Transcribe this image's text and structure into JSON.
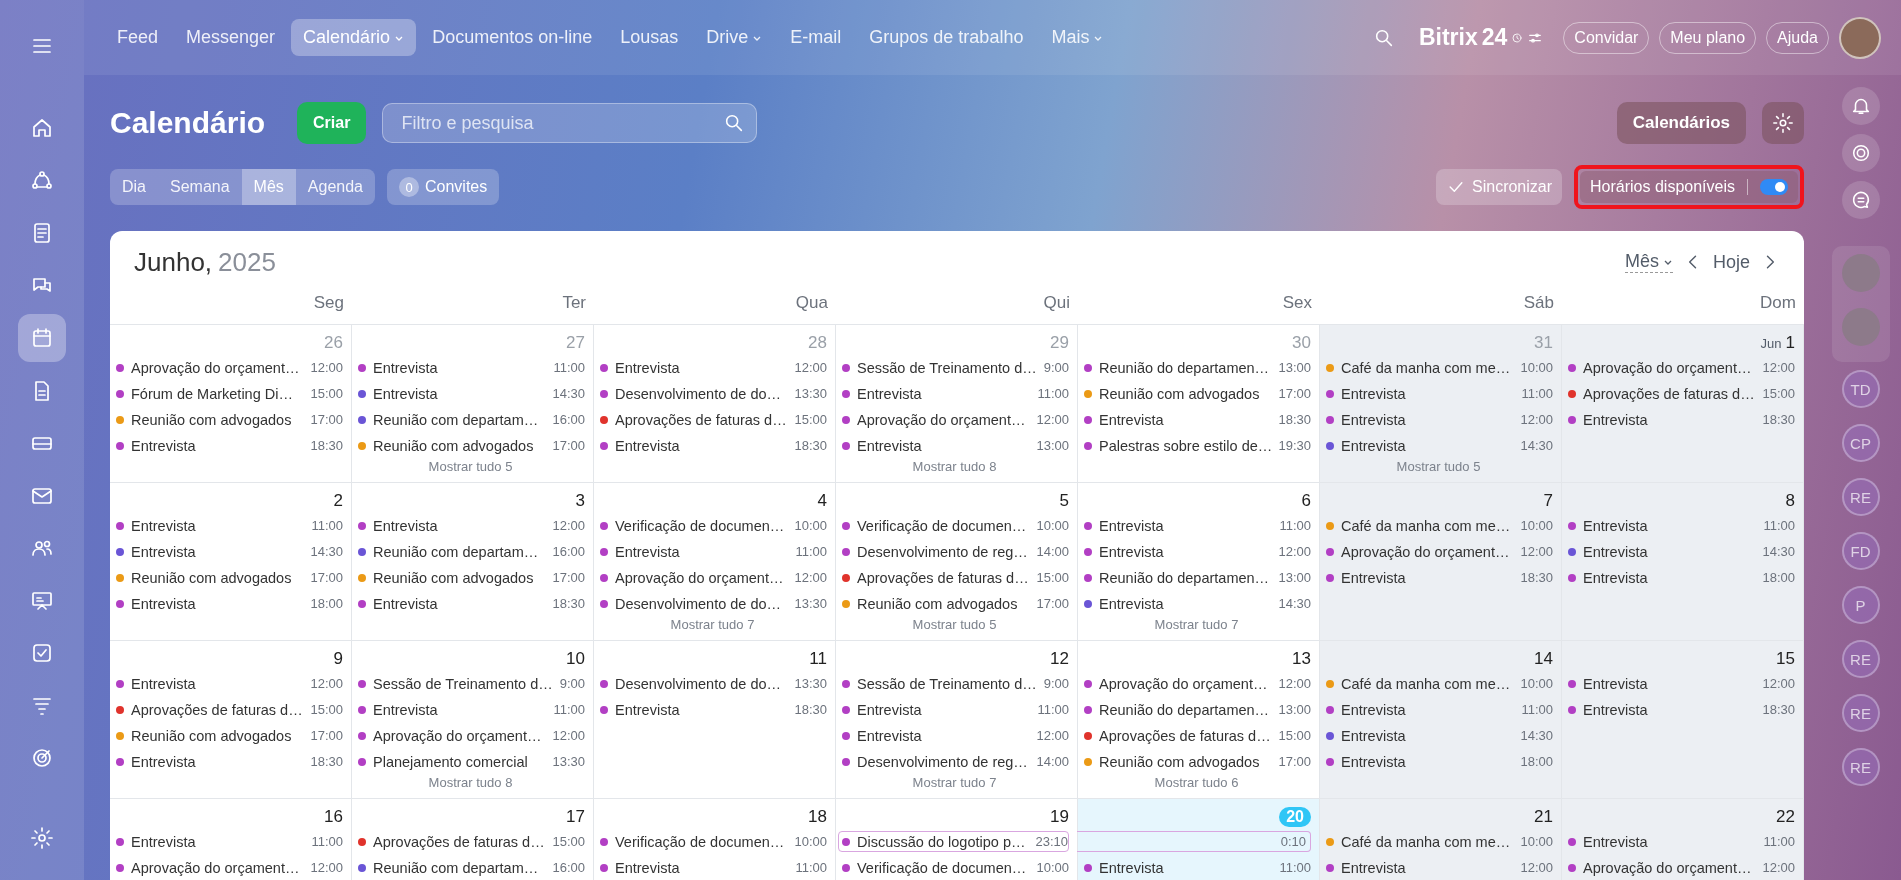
{
  "left_sidebar": {
    "items": [
      {
        "selected": false
      },
      {
        "selected": false
      },
      {
        "selected": false
      },
      {
        "selected": false
      },
      {
        "selected": true
      },
      {
        "selected": false
      },
      {
        "selected": false
      },
      {
        "selected": false
      },
      {
        "selected": false
      },
      {
        "selected": false
      },
      {
        "selected": false
      },
      {
        "selected": false
      },
      {
        "selected": false
      },
      {
        "selected": false
      }
    ]
  },
  "top_nav": [
    {
      "label": "Feed",
      "selected": false,
      "dropdown": false
    },
    {
      "label": "Messenger",
      "selected": false,
      "dropdown": false
    },
    {
      "label": "Calendário",
      "selected": true,
      "dropdown": true
    },
    {
      "label": "Documentos on-line",
      "selected": false,
      "dropdown": false
    },
    {
      "label": "Lousas",
      "selected": false,
      "dropdown": false
    },
    {
      "label": "Drive",
      "selected": false,
      "dropdown": true
    },
    {
      "label": "E-mail",
      "selected": false,
      "dropdown": false
    },
    {
      "label": "Grupos de trabalho",
      "selected": false,
      "dropdown": false
    },
    {
      "label": "Mais",
      "selected": false,
      "dropdown": true
    }
  ],
  "logo": {
    "name": "Bitrix",
    "number": "24"
  },
  "header_buttons": [
    "Convidar",
    "Meu plano",
    "Ajuda"
  ],
  "page_title": "Calendário",
  "create_button": "Criar",
  "search": {
    "placeholder": "Filtro e pesquisa"
  },
  "calendars_button": "Calendários",
  "view_tabs": [
    {
      "label": "Dia",
      "selected": false
    },
    {
      "label": "Semana",
      "selected": false
    },
    {
      "label": "Mês",
      "selected": true
    },
    {
      "label": "Agenda",
      "selected": false
    }
  ],
  "invites": {
    "count": "0",
    "label": "Convites"
  },
  "sync_button": "Sincronizar",
  "available_slots": {
    "label": "Horários disponíveis",
    "on": true
  },
  "calendar": {
    "month": "Junho,",
    "year": "2025",
    "view_select": "Mês",
    "today_button": "Hoje",
    "day_names": [
      {
        "label": "Seg",
        "weekend": false
      },
      {
        "label": "Ter",
        "weekend": false
      },
      {
        "label": "Qua",
        "weekend": false
      },
      {
        "label": "Qui",
        "weekend": false
      },
      {
        "label": "Sex",
        "weekend": false
      },
      {
        "label": "Sáb",
        "weekend": true
      },
      {
        "label": "Dom",
        "weekend": true
      }
    ],
    "weeks": [
      [
        {
          "number": "26",
          "other_month": true,
          "today": false,
          "events": [
            {
              "title": "Aprovação do orçament…",
              "time": "12:00",
              "color": "#b23fc4"
            },
            {
              "title": "Fórum de Marketing Di…",
              "time": "15:00",
              "color": "#b23fc4"
            },
            {
              "title": "Reunião com advogados",
              "time": "17:00",
              "color": "#eb9a16"
            },
            {
              "title": "Entrevista",
              "time": "18:30",
              "color": "#b23fc4"
            }
          ]
        },
        {
          "number": "27",
          "other_month": true,
          "today": false,
          "events": [
            {
              "title": "Entrevista",
              "time": "11:00",
              "color": "#b23fc4"
            },
            {
              "title": "Entrevista",
              "time": "14:30",
              "color": "#6a55d6"
            },
            {
              "title": "Reunião com departam…",
              "time": "16:00",
              "color": "#6a55d6"
            },
            {
              "title": "Reunião com advogados",
              "time": "17:00",
              "color": "#eb9a16"
            }
          ],
          "more": "Mostrar tudo 5"
        },
        {
          "number": "28",
          "other_month": true,
          "today": false,
          "events": [
            {
              "title": "Entrevista",
              "time": "12:00",
              "color": "#b23fc4"
            },
            {
              "title": "Desenvolvimento de do…",
              "time": "13:30",
              "color": "#b23fc4"
            },
            {
              "title": "Aprovações de faturas d…",
              "time": "15:00",
              "color": "#e0332c"
            },
            {
              "title": "Entrevista",
              "time": "18:30",
              "color": "#b23fc4"
            }
          ]
        },
        {
          "number": "29",
          "other_month": true,
          "today": false,
          "events": [
            {
              "title": "Sessão de Treinamento d…",
              "time": "9:00",
              "color": "#b23fc4"
            },
            {
              "title": "Entrevista",
              "time": "11:00",
              "color": "#b23fc4"
            },
            {
              "title": "Aprovação do orçament…",
              "time": "12:00",
              "color": "#b23fc4"
            },
            {
              "title": "Entrevista",
              "time": "13:00",
              "color": "#b23fc4"
            }
          ],
          "more": "Mostrar tudo 8"
        },
        {
          "number": "30",
          "other_month": true,
          "today": false,
          "events": [
            {
              "title": "Reunião do departamen…",
              "time": "13:00",
              "color": "#b23fc4"
            },
            {
              "title": "Reunião com advogados",
              "time": "17:00",
              "color": "#eb9a16"
            },
            {
              "title": "Entrevista",
              "time": "18:30",
              "color": "#b23fc4"
            },
            {
              "title": "Palestras sobre estilo de…",
              "time": "19:30",
              "color": "#b23fc4"
            }
          ]
        },
        {
          "number": "31",
          "other_month": true,
          "today": false,
          "events": [
            {
              "title": "Café da manha com me…",
              "time": "10:00",
              "color": "#eb9a16"
            },
            {
              "title": "Entrevista",
              "time": "11:00",
              "color": "#b23fc4"
            },
            {
              "title": "Entrevista",
              "time": "12:00",
              "color": "#b23fc4"
            },
            {
              "title": "Entrevista",
              "time": "14:30",
              "color": "#6a55d6"
            }
          ],
          "more": "Mostrar tudo 5"
        },
        {
          "month_prefix": "Jun",
          "number": "1",
          "other_month": false,
          "today": false,
          "events": [
            {
              "title": "Aprovação do orçament…",
              "time": "12:00",
              "color": "#b23fc4"
            },
            {
              "title": "Aprovações de faturas d…",
              "time": "15:00",
              "color": "#e0332c"
            },
            {
              "title": "Entrevista",
              "time": "18:30",
              "color": "#b23fc4"
            }
          ]
        }
      ],
      [
        {
          "number": "2",
          "other_month": false,
          "today": false,
          "events": [
            {
              "title": "Entrevista",
              "time": "11:00",
              "color": "#b23fc4"
            },
            {
              "title": "Entrevista",
              "time": "14:30",
              "color": "#6a55d6"
            },
            {
              "title": "Reunião com advogados",
              "time": "17:00",
              "color": "#eb9a16"
            },
            {
              "title": "Entrevista",
              "time": "18:00",
              "color": "#b23fc4"
            }
          ]
        },
        {
          "number": "3",
          "other_month": false,
          "today": false,
          "events": [
            {
              "title": "Entrevista",
              "time": "12:00",
              "color": "#b23fc4"
            },
            {
              "title": "Reunião com departam…",
              "time": "16:00",
              "color": "#6a55d6"
            },
            {
              "title": "Reunião com advogados",
              "time": "17:00",
              "color": "#eb9a16"
            },
            {
              "title": "Entrevista",
              "time": "18:30",
              "color": "#b23fc4"
            }
          ]
        },
        {
          "number": "4",
          "other_month": false,
          "today": false,
          "events": [
            {
              "title": "Verificação de documen…",
              "time": "10:00",
              "color": "#b23fc4"
            },
            {
              "title": "Entrevista",
              "time": "11:00",
              "color": "#b23fc4"
            },
            {
              "title": "Aprovação do orçament…",
              "time": "12:00",
              "color": "#b23fc4"
            },
            {
              "title": "Desenvolvimento de do…",
              "time": "13:30",
              "color": "#b23fc4"
            }
          ],
          "more": "Mostrar tudo 7"
        },
        {
          "number": "5",
          "other_month": false,
          "today": false,
          "events": [
            {
              "title": "Verificação de documen…",
              "time": "10:00",
              "color": "#b23fc4"
            },
            {
              "title": "Desenvolvimento de reg…",
              "time": "14:00",
              "color": "#b23fc4"
            },
            {
              "title": "Aprovações de faturas d…",
              "time": "15:00",
              "color": "#e0332c"
            },
            {
              "title": "Reunião com advogados",
              "time": "17:00",
              "color": "#eb9a16"
            }
          ],
          "more": "Mostrar tudo 5"
        },
        {
          "number": "6",
          "other_month": false,
          "today": false,
          "events": [
            {
              "title": "Entrevista",
              "time": "11:00",
              "color": "#b23fc4"
            },
            {
              "title": "Entrevista",
              "time": "12:00",
              "color": "#b23fc4"
            },
            {
              "title": "Reunião do departamen…",
              "time": "13:00",
              "color": "#b23fc4"
            },
            {
              "title": "Entrevista",
              "time": "14:30",
              "color": "#6a55d6"
            }
          ],
          "more": "Mostrar tudo 7"
        },
        {
          "number": "7",
          "other_month": false,
          "today": false,
          "events": [
            {
              "title": "Café da manha com me…",
              "time": "10:00",
              "color": "#eb9a16"
            },
            {
              "title": "Aprovação do orçament…",
              "time": "12:00",
              "color": "#b23fc4"
            },
            {
              "title": "Entrevista",
              "time": "18:30",
              "color": "#b23fc4"
            }
          ]
        },
        {
          "number": "8",
          "other_month": false,
          "today": false,
          "events": [
            {
              "title": "Entrevista",
              "time": "11:00",
              "color": "#b23fc4"
            },
            {
              "title": "Entrevista",
              "time": "14:30",
              "color": "#6a55d6"
            },
            {
              "title": "Entrevista",
              "time": "18:00",
              "color": "#b23fc4"
            }
          ]
        }
      ],
      [
        {
          "number": "9",
          "other_month": false,
          "today": false,
          "events": [
            {
              "title": "Entrevista",
              "time": "12:00",
              "color": "#b23fc4"
            },
            {
              "title": "Aprovações de faturas d…",
              "time": "15:00",
              "color": "#e0332c"
            },
            {
              "title": "Reunião com advogados",
              "time": "17:00",
              "color": "#eb9a16"
            },
            {
              "title": "Entrevista",
              "time": "18:30",
              "color": "#b23fc4"
            }
          ]
        },
        {
          "number": "10",
          "other_month": false,
          "today": false,
          "events": [
            {
              "title": "Sessão de Treinamento d…",
              "time": "9:00",
              "color": "#b23fc4"
            },
            {
              "title": "Entrevista",
              "time": "11:00",
              "color": "#b23fc4"
            },
            {
              "title": "Aprovação do orçament…",
              "time": "12:00",
              "color": "#b23fc4"
            },
            {
              "title": "Planejamento comercial",
              "time": "13:30",
              "color": "#b23fc4"
            }
          ],
          "more": "Mostrar tudo 8"
        },
        {
          "number": "11",
          "other_month": false,
          "today": false,
          "events": [
            {
              "title": "Desenvolvimento de do…",
              "time": "13:30",
              "color": "#b23fc4"
            },
            {
              "title": "Entrevista",
              "time": "18:30",
              "color": "#b23fc4"
            }
          ]
        },
        {
          "number": "12",
          "other_month": false,
          "today": false,
          "events": [
            {
              "title": "Sessão de Treinamento d…",
              "time": "9:00",
              "color": "#b23fc4"
            },
            {
              "title": "Entrevista",
              "time": "11:00",
              "color": "#b23fc4"
            },
            {
              "title": "Entrevista",
              "time": "12:00",
              "color": "#b23fc4"
            },
            {
              "title": "Desenvolvimento de reg…",
              "time": "14:00",
              "color": "#b23fc4"
            }
          ],
          "more": "Mostrar tudo 7"
        },
        {
          "number": "13",
          "other_month": false,
          "today": false,
          "events": [
            {
              "title": "Aprovação do orçament…",
              "time": "12:00",
              "color": "#b23fc4"
            },
            {
              "title": "Reunião do departamen…",
              "time": "13:00",
              "color": "#b23fc4"
            },
            {
              "title": "Aprovações de faturas d…",
              "time": "15:00",
              "color": "#e0332c"
            },
            {
              "title": "Reunião com advogados",
              "time": "17:00",
              "color": "#eb9a16"
            }
          ],
          "more": "Mostrar tudo 6"
        },
        {
          "number": "14",
          "other_month": false,
          "today": false,
          "events": [
            {
              "title": "Café da manha com me…",
              "time": "10:00",
              "color": "#eb9a16"
            },
            {
              "title": "Entrevista",
              "time": "11:00",
              "color": "#b23fc4"
            },
            {
              "title": "Entrevista",
              "time": "14:30",
              "color": "#6a55d6"
            },
            {
              "title": "Entrevista",
              "time": "18:00",
              "color": "#b23fc4"
            }
          ]
        },
        {
          "number": "15",
          "other_month": false,
          "today": false,
          "events": [
            {
              "title": "Entrevista",
              "time": "12:00",
              "color": "#b23fc4"
            },
            {
              "title": "Entrevista",
              "time": "18:30",
              "color": "#b23fc4"
            }
          ]
        }
      ],
      [
        {
          "number": "16",
          "other_month": false,
          "today": false,
          "events": [
            {
              "title": "Entrevista",
              "time": "11:00",
              "color": "#b23fc4"
            },
            {
              "title": "Aprovação do orçament…",
              "time": "12:00",
              "color": "#b23fc4"
            }
          ]
        },
        {
          "number": "17",
          "other_month": false,
          "today": false,
          "events": [
            {
              "title": "Aprovações de faturas d…",
              "time": "15:00",
              "color": "#e0332c"
            },
            {
              "title": "Reunião com departam…",
              "time": "16:00",
              "color": "#6a55d6"
            }
          ]
        },
        {
          "number": "18",
          "other_month": false,
          "today": false,
          "events": [
            {
              "title": "Verificação de documen…",
              "time": "10:00",
              "color": "#b23fc4"
            },
            {
              "title": "Entrevista",
              "time": "11:00",
              "color": "#b23fc4"
            }
          ]
        },
        {
          "number": "19",
          "other_month": false,
          "today": false,
          "events": [
            {
              "kind": "span_start",
              "title": "Discussão do logotipo p…",
              "time": "23:10",
              "color": "#b23fc4"
            },
            {
              "title": "Verificação de documen…",
              "time": "10:00",
              "color": "#b23fc4"
            }
          ]
        },
        {
          "number": "20",
          "other_month": false,
          "today": true,
          "events": [
            {
              "kind": "span_end",
              "time": "0:10"
            },
            {
              "title": "Entrevista",
              "time": "11:00",
              "color": "#b23fc4"
            }
          ]
        },
        {
          "number": "21",
          "other_month": false,
          "today": false,
          "events": [
            {
              "title": "Café da manha com me…",
              "time": "10:00",
              "color": "#eb9a16"
            },
            {
              "title": "Entrevista",
              "time": "12:00",
              "color": "#b23fc4"
            }
          ]
        },
        {
          "number": "22",
          "other_month": false,
          "today": false,
          "events": [
            {
              "title": "Entrevista",
              "time": "11:00",
              "color": "#b23fc4"
            },
            {
              "title": "Aprovação do orçament…",
              "time": "12:00",
              "color": "#b23fc4"
            }
          ]
        }
      ]
    ]
  },
  "right_rail": {
    "avatars": [
      {
        "kind": "photo"
      },
      {
        "kind": "photo"
      },
      {
        "kind": "initials",
        "initials": "TD"
      },
      {
        "kind": "initials",
        "initials": "CP"
      },
      {
        "kind": "initials",
        "initials": "RE"
      },
      {
        "kind": "initials",
        "initials": "FD"
      },
      {
        "kind": "initials",
        "initials": "P"
      },
      {
        "kind": "initials",
        "initials": "RE"
      },
      {
        "kind": "initials",
        "initials": "RE"
      },
      {
        "kind": "initials",
        "initials": "RE"
      }
    ]
  }
}
